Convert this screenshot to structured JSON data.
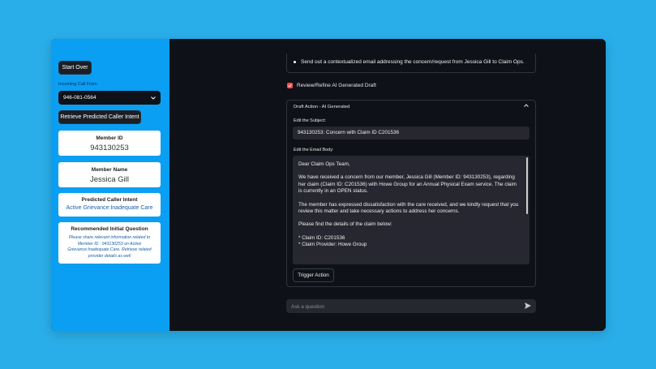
{
  "sidebar": {
    "start_over": "Start Over",
    "incoming_label": "Incoming Call From",
    "phone_value": "946-081-0564",
    "retrieve_button": "Retrieve Predicted Caller Intent",
    "member_id_title": "Member ID",
    "member_id_value": "943130253",
    "member_name_title": "Member Name",
    "member_name_value": "Jessica Gill",
    "intent_title": "Predicted Caller Intent",
    "intent_value": "Active Grievance:Inadequate Care",
    "question_title": "Recommended Initial Question",
    "question_lines": [
      "Please share relevant information related to",
      "Member ID : 943130253 on Active",
      "Grievance:Inadequate Care. Retrieve related",
      "provider details as well"
    ]
  },
  "main": {
    "bullet_text": "Send out a contextualized email addressing the concern/request from Jessica Gill to Claim Ops.",
    "checkbox_label": "Review/Refine AI Generated Draft",
    "draft_header": "Draft Action - AI Generated",
    "subject_label": "Edit the Subject:",
    "subject_value": "943130253: Concern with Claim ID C201536",
    "body_label": "Edit the Email Body:",
    "body_paragraphs": [
      "Dear Claim Ops Team,",
      "We have received a concern from our member, Jessica Gill (Member ID: 943130253), regarding her claim (Claim ID: C201536) with Howe Group for an Annual Physical Exam service. The claim is currently in an OPEN status.",
      "The member has expressed dissatisfaction with the care received, and we kindly request that you review this matter and take necessary actions to address her concerns.",
      "Please find the details of the claim below:"
    ],
    "body_list": [
      "* Claim ID: C201536",
      "* Claim Provider: Howe Group"
    ],
    "trigger_button": "Trigger Action",
    "chat_placeholder": "Ask a question"
  },
  "colors": {
    "page_bg": "#2aaee9",
    "sidebar_bg": "#0a9ff2",
    "main_bg": "#0e1117",
    "checkbox_accent": "#ff4b4b"
  },
  "icons": {
    "select_chevron": "chevron-down-icon",
    "expander_chevron": "chevron-up-icon",
    "send": "send-icon",
    "checkbox": "checkmark-icon"
  }
}
